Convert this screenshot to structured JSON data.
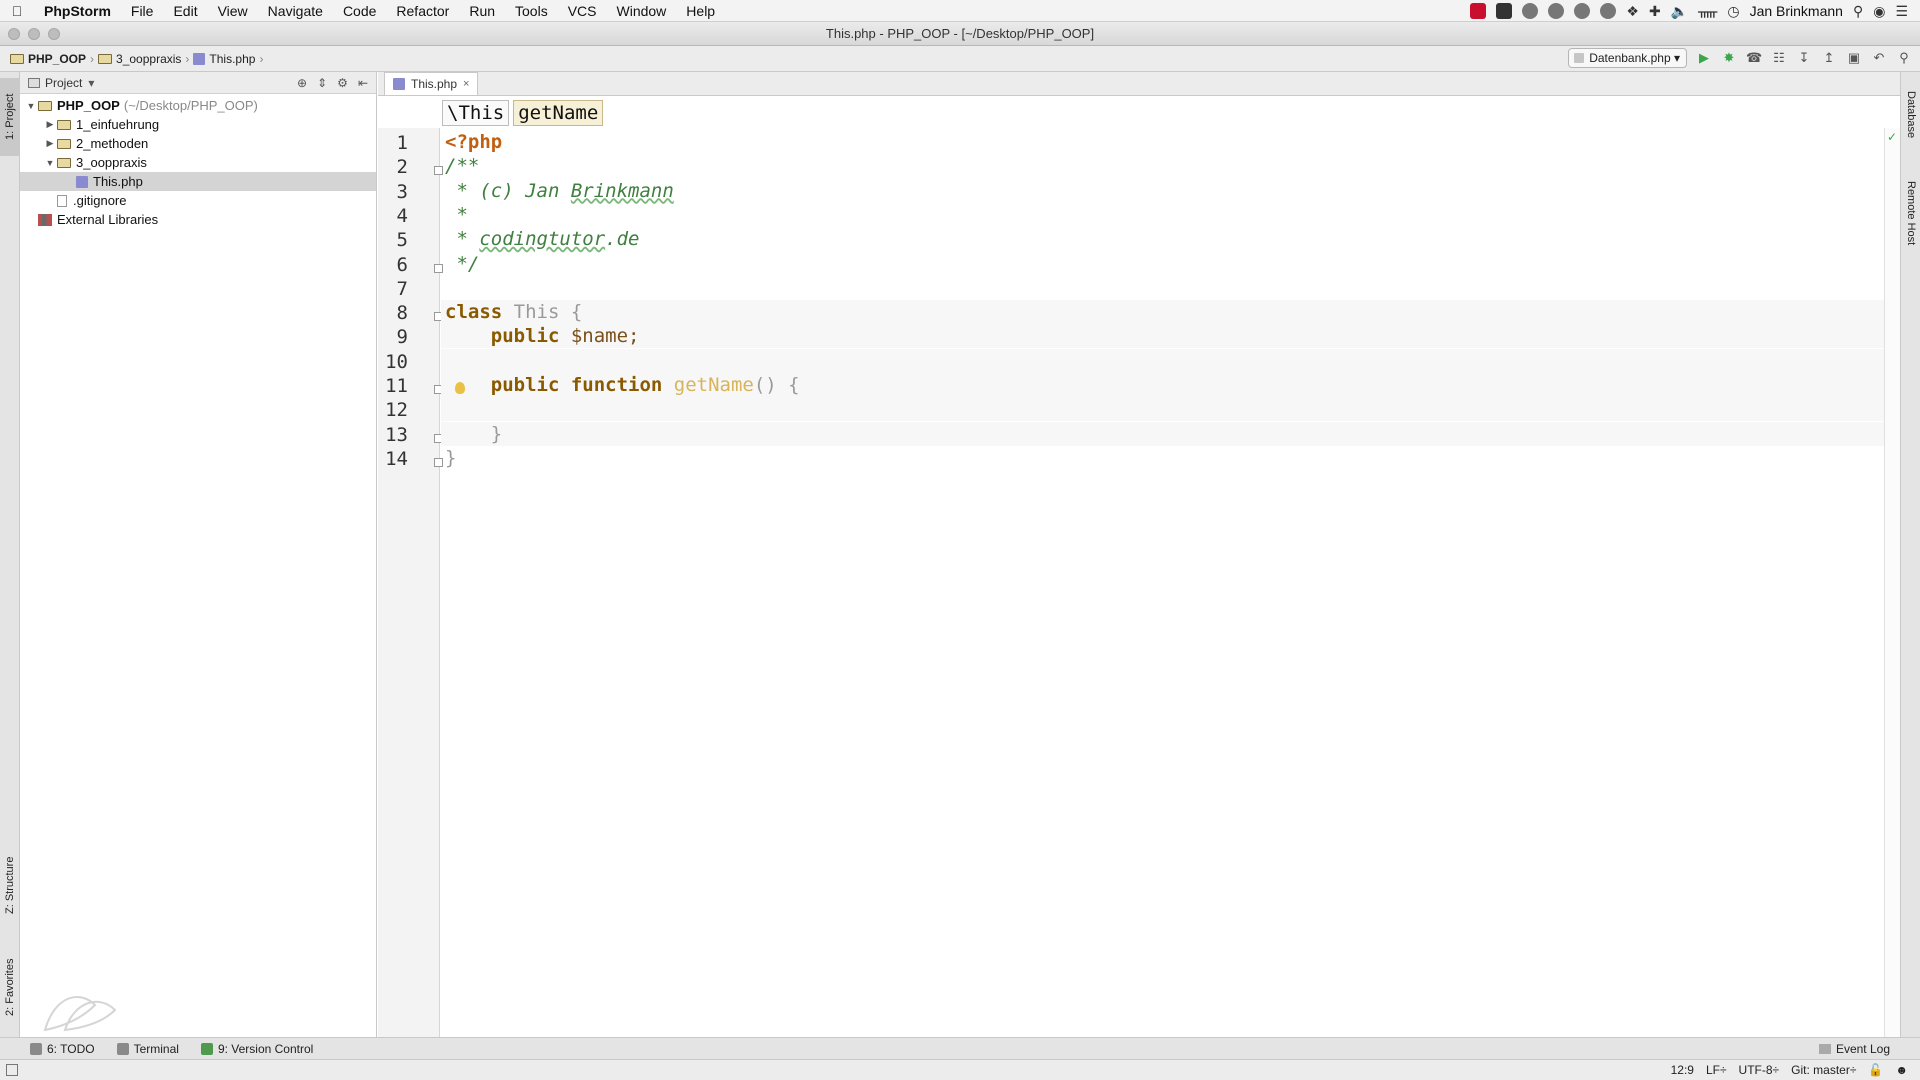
{
  "menubar": {
    "app_name": "PhpStorm",
    "items": [
      "File",
      "Edit",
      "View",
      "Navigate",
      "Code",
      "Refactor",
      "Run",
      "Tools",
      "VCS",
      "Window",
      "Help"
    ],
    "user": "Jan Brinkmann"
  },
  "window": {
    "title": "This.php - PHP_OOP - [~/Desktop/PHP_OOP]"
  },
  "navbar": {
    "breadcrumb": [
      "PHP_OOP",
      "3_ooppraxis",
      "This.php"
    ],
    "run_config": "Datenbank.php"
  },
  "left_stripe": {
    "project_tab": "1: Project",
    "structure_tab": "Z: Structure",
    "favorites_tab": "2: Favorites"
  },
  "right_stripe": {
    "database_tab": "Database",
    "remote_host_tab": "Remote Host"
  },
  "project_panel": {
    "header": "Project",
    "tree": [
      {
        "label": "PHP_OOP",
        "path": "(~/Desktop/PHP_OOP)",
        "level": 0,
        "type": "folder",
        "expanded": true
      },
      {
        "label": "1_einfuehrung",
        "level": 1,
        "type": "folder",
        "expanded": false
      },
      {
        "label": "2_methoden",
        "level": 1,
        "type": "folder",
        "expanded": false
      },
      {
        "label": "3_ooppraxis",
        "level": 1,
        "type": "folder",
        "expanded": true
      },
      {
        "label": "This.php",
        "level": 2,
        "type": "php",
        "selected": true
      },
      {
        "label": ".gitignore",
        "level": 1,
        "type": "file"
      },
      {
        "label": "External Libraries",
        "level": 0,
        "type": "library"
      }
    ]
  },
  "editor": {
    "tab_label": "This.php",
    "tab_close": "×",
    "breadcrumb": [
      "\\This",
      "getName"
    ],
    "line_numbers": [
      "1",
      "2",
      "3",
      "4",
      "5",
      "6",
      "7",
      "8",
      "9",
      "10",
      "11",
      "12",
      "13",
      "14"
    ],
    "lines": [
      [
        {
          "t": "<?php",
          "c": "php-tag"
        }
      ],
      [
        {
          "t": "/**",
          "c": "cm"
        }
      ],
      [
        {
          "t": " * (c) Jan ",
          "c": "cm"
        },
        {
          "t": "Brinkmann",
          "c": "cm-u"
        }
      ],
      [
        {
          "t": " *",
          "c": "cm"
        }
      ],
      [
        {
          "t": " * ",
          "c": "cm"
        },
        {
          "t": "codingtutor",
          "c": "cm-u"
        },
        {
          "t": ".de",
          "c": "cm"
        }
      ],
      [
        {
          "t": " */",
          "c": "cm"
        }
      ],
      [],
      [
        {
          "t": "class ",
          "c": "kw"
        },
        {
          "t": "This {",
          "c": "cls"
        }
      ],
      [
        {
          "t": "    public ",
          "c": "kw"
        },
        {
          "t": "$name;",
          "c": "var"
        }
      ],
      [],
      [
        {
          "t": "    public function ",
          "c": "kw"
        },
        {
          "t": "getName",
          "c": "fn"
        },
        {
          "t": "() {",
          "c": "dim"
        }
      ],
      [],
      [
        {
          "t": "    }",
          "c": "dim"
        }
      ],
      [
        {
          "t": "}",
          "c": "dim"
        }
      ]
    ]
  },
  "bottom_tools": {
    "todo": "6: TODO",
    "terminal": "Terminal",
    "version_control": "9: Version Control",
    "event_log": "Event Log"
  },
  "statusbar": {
    "position": "12:9",
    "line_sep": "LF÷",
    "encoding": "UTF-8÷",
    "git": "Git: master÷"
  }
}
